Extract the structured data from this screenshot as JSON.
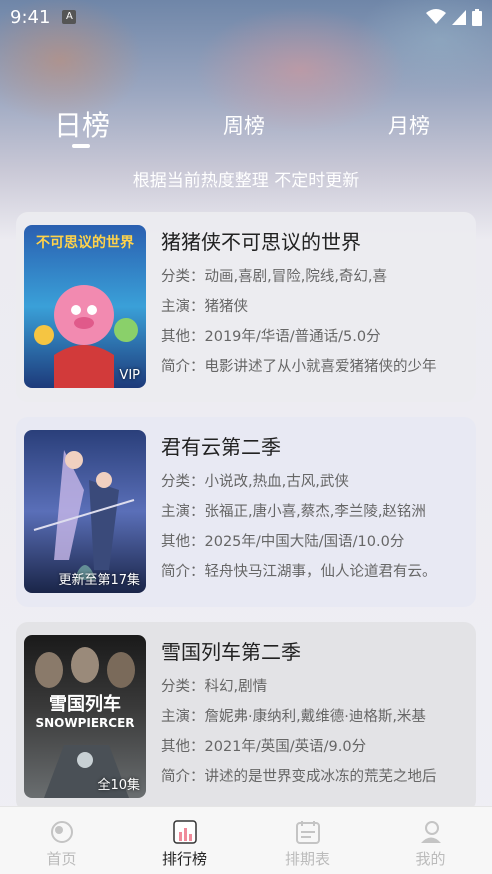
{
  "status": {
    "time": "9:41",
    "a_label": "A"
  },
  "tabs": [
    {
      "label": "日榜",
      "active": true
    },
    {
      "label": "周榜",
      "active": false
    },
    {
      "label": "月榜",
      "active": false
    }
  ],
  "subtitle": "根据当前热度整理 不定时更新",
  "movies": [
    {
      "title": "猪猪侠不可思议的世界",
      "category": "分类：动画,喜剧,冒险,院线,奇幻,喜",
      "cast": "主演：猪猪侠",
      "other": "其他：2019年/华语/普通话/5.0分",
      "intro": "简介：电影讲述了从小就喜爱猪猪侠的少年",
      "badge": "VIP",
      "poster_text": "不可思议的世界"
    },
    {
      "title": "君有云第二季",
      "category": "分类：小说改,热血,古风,武侠",
      "cast": "主演：张福正,唐小喜,蔡杰,李兰陵,赵铭洲",
      "other": "其他：2025年/中国大陆/国语/10.0分",
      "intro": "简介：轻舟快马江湖事，仙人论道君有云。",
      "badge": "更新至第17集",
      "poster_text": ""
    },
    {
      "title": "雪国列车第二季",
      "category": "分类：科幻,剧情",
      "cast": "主演：詹妮弗·康纳利,戴维德·迪格斯,米基",
      "other": "其他：2021年/英国/英语/9.0分",
      "intro": "简介：讲述的是世界变成冰冻的荒芜之地后",
      "badge": "全10集",
      "poster_text": "雪国列车",
      "poster_text_en": "SNOWPIERCER"
    }
  ],
  "nav": [
    {
      "label": "首页",
      "icon": "home-icon",
      "active": false
    },
    {
      "label": "排行榜",
      "icon": "ranking-icon",
      "active": true
    },
    {
      "label": "排期表",
      "icon": "calendar-icon",
      "active": false
    },
    {
      "label": "我的",
      "icon": "profile-icon",
      "active": false
    }
  ]
}
